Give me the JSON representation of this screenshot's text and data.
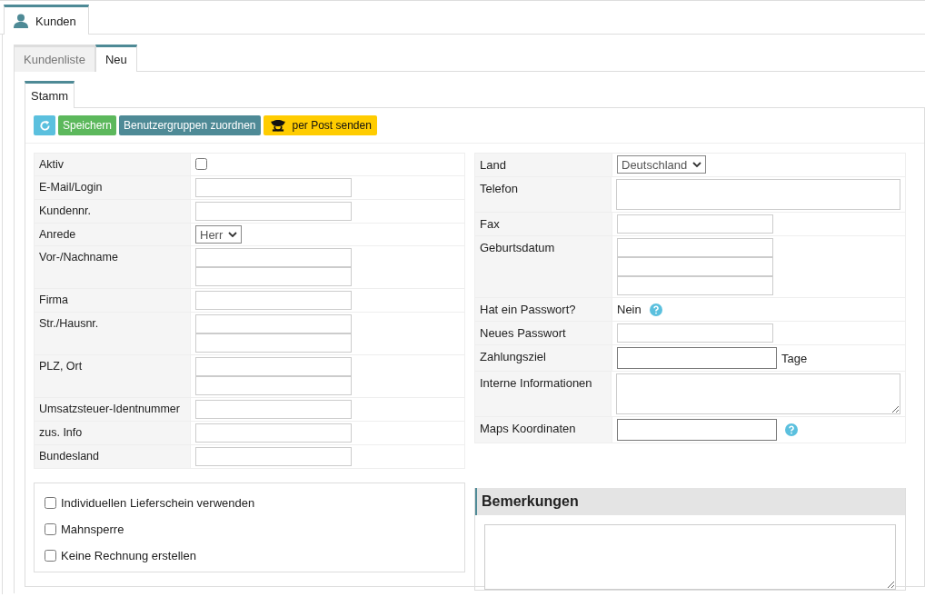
{
  "main_tabs": [
    {
      "label": "Kunden",
      "selected": true
    }
  ],
  "sub_tabs": [
    {
      "label": "Kundenliste",
      "selected": false
    },
    {
      "label": "Neu",
      "selected": true
    }
  ],
  "section_tabs": [
    {
      "label": "Stamm",
      "selected": true
    }
  ],
  "toolbar": [
    {
      "kind": "refresh"
    },
    {
      "kind": "save",
      "label": "Speichern"
    },
    {
      "kind": "groups",
      "label": "Benutzergruppen zuordnen"
    },
    {
      "kind": "post",
      "label": "per Post senden"
    }
  ],
  "left_form": [
    {
      "label": "Aktiv",
      "controls": [
        {
          "kind": "checkbox",
          "checked": false
        }
      ]
    },
    {
      "label": "E-Mail/Login",
      "controls": [
        {
          "kind": "input"
        }
      ]
    },
    {
      "label": "Kundennr.",
      "controls": [
        {
          "kind": "input"
        }
      ]
    },
    {
      "label": "Anrede",
      "controls": [
        {
          "kind": "select",
          "value": "Herr"
        }
      ]
    },
    {
      "label": "Vor-/Nachname",
      "controls": [
        {
          "kind": "input"
        },
        {
          "kind": "input"
        }
      ]
    },
    {
      "label": "Firma",
      "controls": [
        {
          "kind": "input"
        }
      ]
    },
    {
      "label": "Str./Hausnr.",
      "controls": [
        {
          "kind": "input"
        },
        {
          "kind": "input"
        }
      ]
    },
    {
      "label": "PLZ, Ort",
      "controls": [
        {
          "kind": "input"
        },
        {
          "kind": "input"
        }
      ]
    },
    {
      "label": "Umsatzsteuer-Identnummer",
      "controls": [
        {
          "kind": "input"
        }
      ]
    },
    {
      "label": "zus. Info",
      "controls": [
        {
          "kind": "input"
        }
      ]
    },
    {
      "label": "Bundesland",
      "controls": [
        {
          "kind": "input"
        }
      ]
    }
  ],
  "right_form": [
    {
      "label": "Land",
      "controls": [
        {
          "kind": "select",
          "value": "Deutschland"
        }
      ]
    },
    {
      "label": "Telefon",
      "controls": [
        {
          "kind": "wide-input"
        }
      ]
    },
    {
      "label": "Fax",
      "controls": [
        {
          "kind": "input"
        }
      ]
    },
    {
      "label": "Geburtsdatum",
      "controls": [
        {
          "kind": "input"
        },
        {
          "kind": "input"
        },
        {
          "kind": "input"
        }
      ]
    },
    {
      "label": "Hat ein Passwort?",
      "controls": [
        {
          "kind": "text",
          "text": "Nein"
        },
        {
          "kind": "help"
        }
      ]
    },
    {
      "label": "Neues Passwort",
      "controls": [
        {
          "kind": "input"
        }
      ]
    },
    {
      "label": "Zahlungsziel",
      "controls": [
        {
          "kind": "dark-input"
        },
        {
          "kind": "text",
          "text": "Tage"
        }
      ]
    },
    {
      "label": "Interne Informationen",
      "controls": [
        {
          "kind": "textarea"
        }
      ]
    },
    {
      "label": "Maps Koordinaten",
      "controls": [
        {
          "kind": "dark-input"
        },
        {
          "kind": "help"
        }
      ]
    }
  ],
  "options": [
    {
      "label": "Individuellen Lieferschein verwenden",
      "checked": false
    },
    {
      "label": "Mahnsperre",
      "checked": false
    },
    {
      "label": "Keine Rechnung erstellen",
      "checked": false
    }
  ],
  "remarks": {
    "title": "Bemerkungen"
  }
}
